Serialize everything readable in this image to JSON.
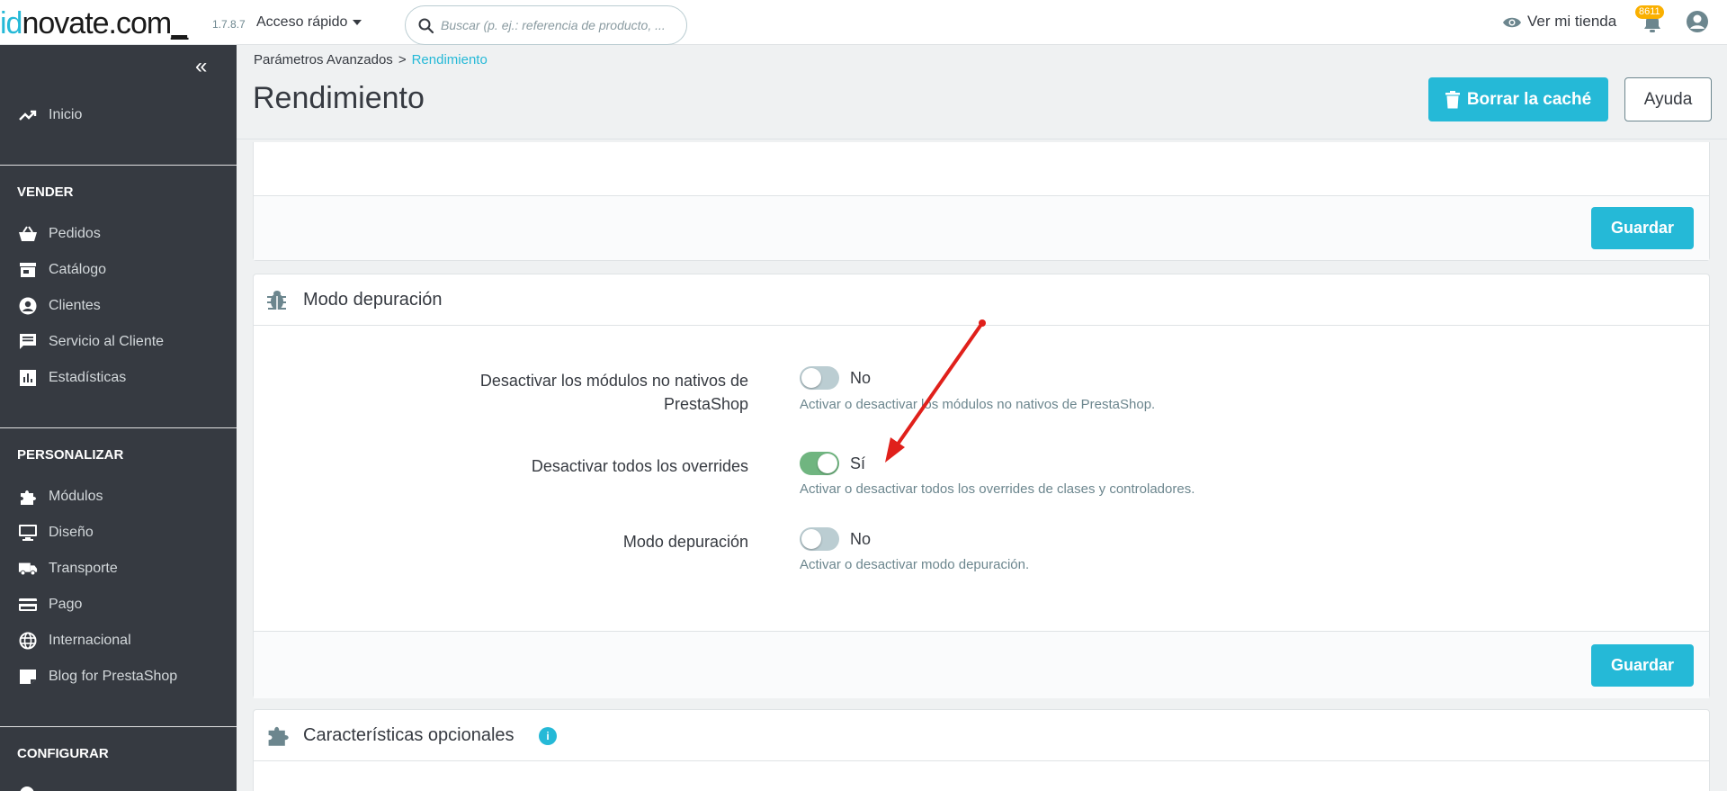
{
  "header": {
    "logo_prefix": "id",
    "logo_main": "novate.com",
    "logo_suffix": "_",
    "version": "1.7.8.7",
    "quick_access": "Acceso rápido",
    "search_placeholder": "Buscar (p. ej.: referencia de producto, ...",
    "view_store": "Ver mi tienda",
    "notifications_count": "8611"
  },
  "sidebar": {
    "home": "Inicio",
    "sections": [
      {
        "title": "VENDER",
        "items": [
          "Pedidos",
          "Catálogo",
          "Clientes",
          "Servicio al Cliente",
          "Estadísticas"
        ]
      },
      {
        "title": "PERSONALIZAR",
        "items": [
          "Módulos",
          "Diseño",
          "Transporte",
          "Pago",
          "Internacional",
          "Blog for PrestaShop"
        ]
      },
      {
        "title": "CONFIGURAR",
        "items": []
      }
    ]
  },
  "page": {
    "breadcrumb_parent": "Parámetros Avanzados",
    "breadcrumb_sep": ">",
    "breadcrumb_current": "Rendimiento",
    "title": "Rendimiento",
    "clear_cache_label": "Borrar la caché",
    "help_label": "Ayuda"
  },
  "card_top": {
    "save_label": "Guardar"
  },
  "debug_card": {
    "title": "Modo depuración",
    "save_label": "Guardar",
    "rows": [
      {
        "label_line1": "Desactivar los módulos no nativos de",
        "label_line2": "PrestaShop",
        "state": "No",
        "on": false,
        "help": "Activar o desactivar los módulos no nativos de PrestaShop."
      },
      {
        "label_line1": "Desactivar todos los overrides",
        "label_line2": "",
        "state": "Sí",
        "on": true,
        "help": "Activar o desactivar todos los overrides de clases y controladores."
      },
      {
        "label_line1": "Modo depuración",
        "label_line2": "",
        "state": "No",
        "on": false,
        "help": "Activar o desactivar modo depuración."
      }
    ]
  },
  "optional_card": {
    "title": "Características opcionales",
    "info": "i"
  },
  "colors": {
    "accent": "#25b9d7",
    "sidebar": "#363a41",
    "toggle_on": "#70b580",
    "annotation": "#e0201b"
  }
}
